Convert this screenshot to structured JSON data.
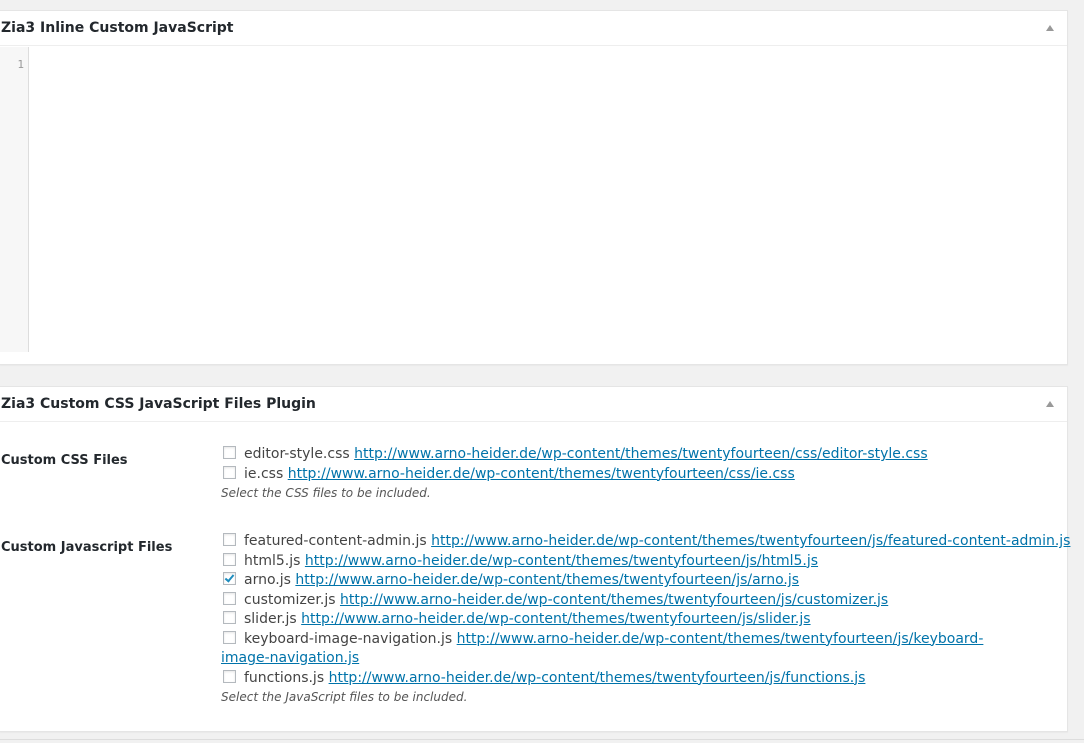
{
  "inline_js_box": {
    "title": "Zia3 Inline Custom JavaScript",
    "editor": {
      "line_number": "1",
      "content": ""
    }
  },
  "plugin_box": {
    "title": "Zia3 Custom CSS JavaScript Files Plugin",
    "css_section": {
      "label": "Custom CSS Files",
      "files": [
        {
          "name": "editor-style.css",
          "url": "http://www.arno-heider.de/wp-content/themes/twentyfourteen/css/editor-style.css",
          "checked": false
        },
        {
          "name": "ie.css",
          "url": "http://www.arno-heider.de/wp-content/themes/twentyfourteen/css/ie.css",
          "checked": false
        }
      ],
      "description": "Select the CSS files to be included."
    },
    "js_section": {
      "label": "Custom Javascript Files",
      "files": [
        {
          "name": "featured-content-admin.js",
          "url": "http://www.arno-heider.de/wp-content/themes/twentyfourteen/js/featured-content-admin.js",
          "checked": false
        },
        {
          "name": "html5.js",
          "url": "http://www.arno-heider.de/wp-content/themes/twentyfourteen/js/html5.js",
          "checked": false
        },
        {
          "name": "arno.js",
          "url": "http://www.arno-heider.de/wp-content/themes/twentyfourteen/js/arno.js",
          "checked": true
        },
        {
          "name": "customizer.js",
          "url": "http://www.arno-heider.de/wp-content/themes/twentyfourteen/js/customizer.js",
          "checked": false
        },
        {
          "name": "slider.js",
          "url": "http://www.arno-heider.de/wp-content/themes/twentyfourteen/js/slider.js",
          "checked": false
        },
        {
          "name": "keyboard-image-navigation.js",
          "url": "http://www.arno-heider.de/wp-content/themes/twentyfourteen/js/keyboard-image-navigation.js",
          "checked": false
        },
        {
          "name": "functions.js",
          "url": "http://www.arno-heider.de/wp-content/themes/twentyfourteen/js/functions.js",
          "checked": false
        }
      ],
      "description": "Select the JavaScript files to be included."
    }
  },
  "colors": {
    "link": "#0073aa",
    "check": "#1e8cbe",
    "background": "#f1f1f1"
  }
}
